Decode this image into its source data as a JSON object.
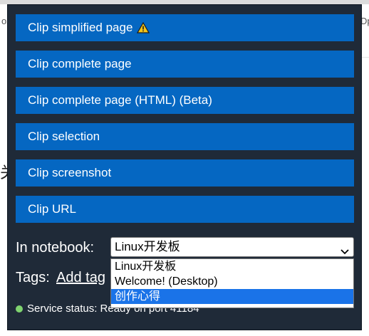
{
  "background": {
    "left_fragment": "关",
    "right_fragment_top": "Dp",
    "left_fragment_top": "os"
  },
  "clip_buttons": [
    {
      "label": "Clip simplified page",
      "warning": true
    },
    {
      "label": "Clip complete page",
      "warning": false
    },
    {
      "label": "Clip complete page (HTML) (Beta)",
      "warning": false
    },
    {
      "label": "Clip selection",
      "warning": false
    },
    {
      "label": "Clip screenshot",
      "warning": false
    },
    {
      "label": "Clip URL",
      "warning": false
    }
  ],
  "notebook": {
    "label": "In notebook:",
    "selected": "Linux开发板",
    "options": [
      "Linux开发板",
      "Welcome! (Desktop)",
      "创作心得"
    ],
    "highlighted_option": "创作心得"
  },
  "tags": {
    "label": "Tags:",
    "link": "Add tag"
  },
  "status": {
    "text": "Service status: Ready on port 41184",
    "color": "#7fd36f"
  },
  "colors": {
    "popup_bg": "#1f2a38",
    "button_bg": "#0567c2",
    "highlight": "#1a73e8"
  },
  "icons": {
    "warning": "warning-triangle-icon",
    "chevron": "chevron-down-icon"
  }
}
